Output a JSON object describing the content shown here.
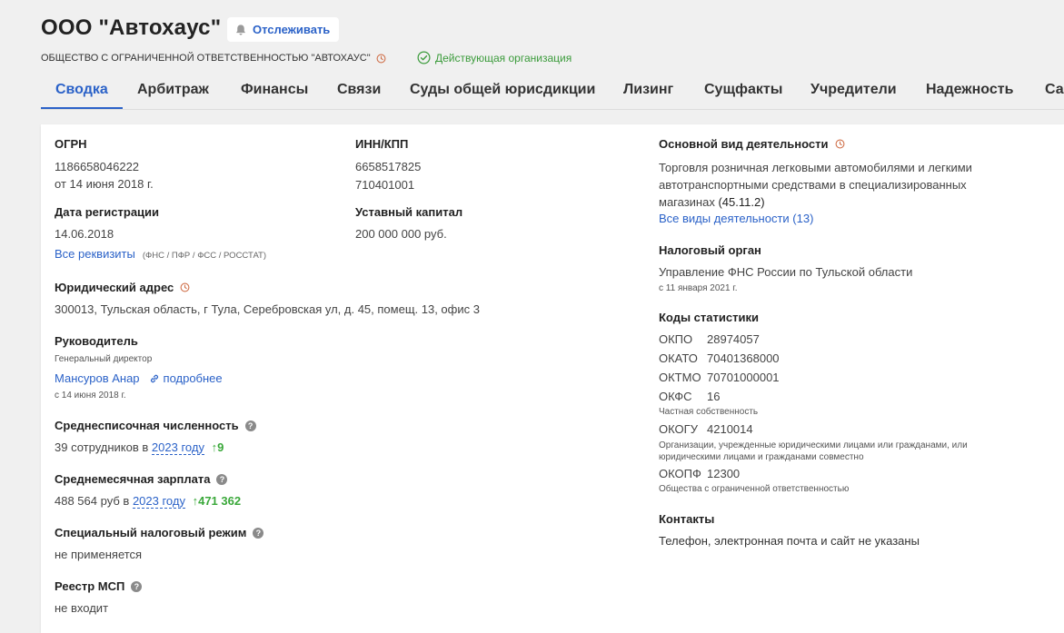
{
  "header": {
    "company_name": "ООО \"Автохаус\"",
    "follow_label": "Отслеживать",
    "full_name": "ОБЩЕСТВО С ОГРАНИЧЕННОЙ ОТВЕТСТВЕННОСТЬЮ \"АВТОХАУС\"",
    "status": "Действующая организация"
  },
  "tabs": [
    "Сводка",
    "Арбитраж",
    "Финансы",
    "Связи",
    "Суды общей юрисдикции",
    "Лизинг",
    "Сущфакты",
    "Учредители",
    "Надежность",
    "Са"
  ],
  "left": {
    "ogrn_label": "ОГРН",
    "ogrn_value": "1186658046222",
    "ogrn_date": "от 14 июня 2018 г.",
    "reg_label": "Дата регистрации",
    "reg_value": "14.06.2018",
    "all_details_link": "Все реквизиты",
    "all_details_sources": "(ФНС / ПФР / ФСС / РОССТАТ)",
    "address_label": "Юридический адрес",
    "address_value": "300013, Тульская область, г Тула, Серебровская ул, д. 45, помещ. 13, офис 3",
    "head_label": "Руководитель",
    "head_position": "Генеральный директор",
    "head_name": "Мансуров Анар",
    "head_more": "подробнее",
    "head_since": "с 14 июня 2018 г.",
    "headcount_label": "Среднесписочная численность",
    "headcount_text": "39 сотрудников в",
    "headcount_year": "2023 году",
    "headcount_delta": "↑9",
    "salary_label": "Среднемесячная зарплата",
    "salary_text": "488 564 руб в",
    "salary_year": "2023 году",
    "salary_delta": "↑471 362",
    "tax_regime_label": "Специальный налоговый режим",
    "tax_regime_value": "не применяется",
    "msp_label": "Реестр МСП",
    "msp_value": "не входит"
  },
  "middle": {
    "inn_label": "ИНН/КПП",
    "inn_value": "6658517825",
    "kpp_value": "710401001",
    "capital_label": "Уставный капитал",
    "capital_value": "200 000 000 руб."
  },
  "right": {
    "activity_label": "Основной вид деятельности",
    "activity_text": "Торговля розничная легковыми автомобилями и легкими автотранспортными средствами в специализированных магазинах",
    "activity_code": "(45.11.2)",
    "activity_all_link": "Все виды деятельности (13)",
    "tax_authority_label": "Налоговый орган",
    "tax_authority_value": "Управление ФНС России по Тульской области",
    "tax_authority_since": "с 11 января 2021 г.",
    "stat_codes_label": "Коды статистики",
    "okpo_code": "ОКПО",
    "okpo_value": "28974057",
    "okato_code": "ОКАТО",
    "okato_value": "70401368000",
    "oktmo_code": "ОКТМО",
    "oktmo_value": "70701000001",
    "okfs_code": "ОКФС",
    "okfs_value": "16",
    "okfs_desc": "Частная собственность",
    "okogu_code": "ОКОГУ",
    "okogu_value": "4210014",
    "okogu_desc": "Организации, учрежденные юридическими лицами или гражданами, или юридическими лицами и гражданами совместно",
    "okopf_code": "ОКОПФ",
    "okopf_value": "12300",
    "okopf_desc": "Общества с ограниченной ответственностью",
    "contacts_label": "Контакты",
    "contacts_value": "Телефон, электронная почта и сайт не указаны"
  },
  "colors": {
    "accent": "#2b62c8",
    "success": "#3aa83a",
    "clock_icon": "#d0704a"
  }
}
